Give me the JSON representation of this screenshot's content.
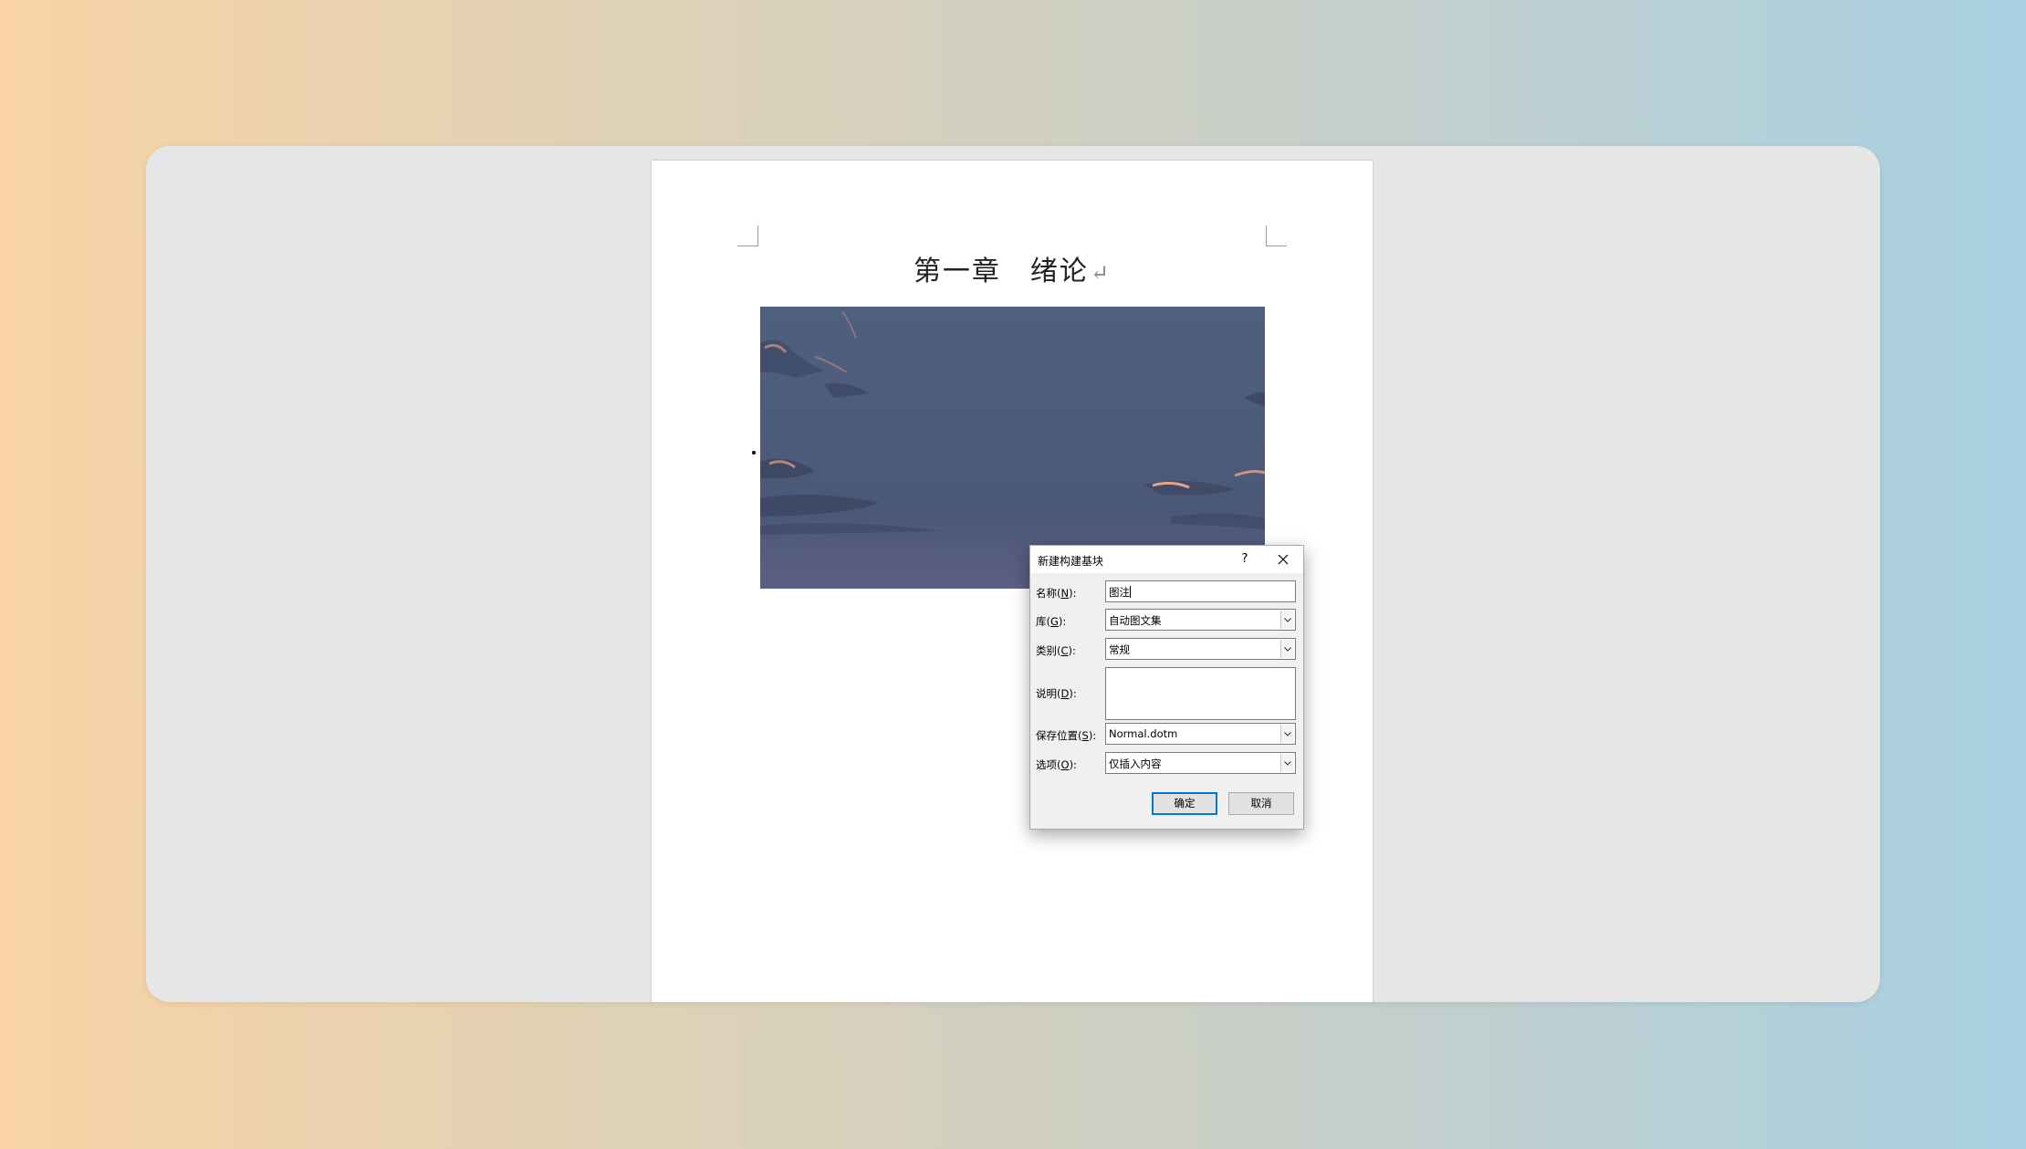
{
  "document": {
    "heading": "第一章　绪论",
    "paragraph_mark": "↵"
  },
  "dialog": {
    "title": "新建构建基块",
    "help_label": "?",
    "fields": {
      "name": {
        "label_pre": "名称(",
        "key": "N",
        "label_post": "):",
        "value": "图注"
      },
      "gallery": {
        "label_pre": "库(",
        "key": "G",
        "label_post": "):",
        "value": "自动图文集"
      },
      "category": {
        "label_pre": "类别(",
        "key": "C",
        "label_post": "):",
        "value": "常规"
      },
      "description": {
        "label_pre": "说明(",
        "key": "D",
        "label_post": "):",
        "value": ""
      },
      "save_in": {
        "label_pre": "保存位置(",
        "key": "S",
        "label_post": "):",
        "value": "Normal.dotm"
      },
      "options": {
        "label_pre": "选项(",
        "key": "O",
        "label_post": "):",
        "value": "仅插入内容"
      }
    },
    "ok_label": "确定",
    "cancel_label": "取消"
  }
}
